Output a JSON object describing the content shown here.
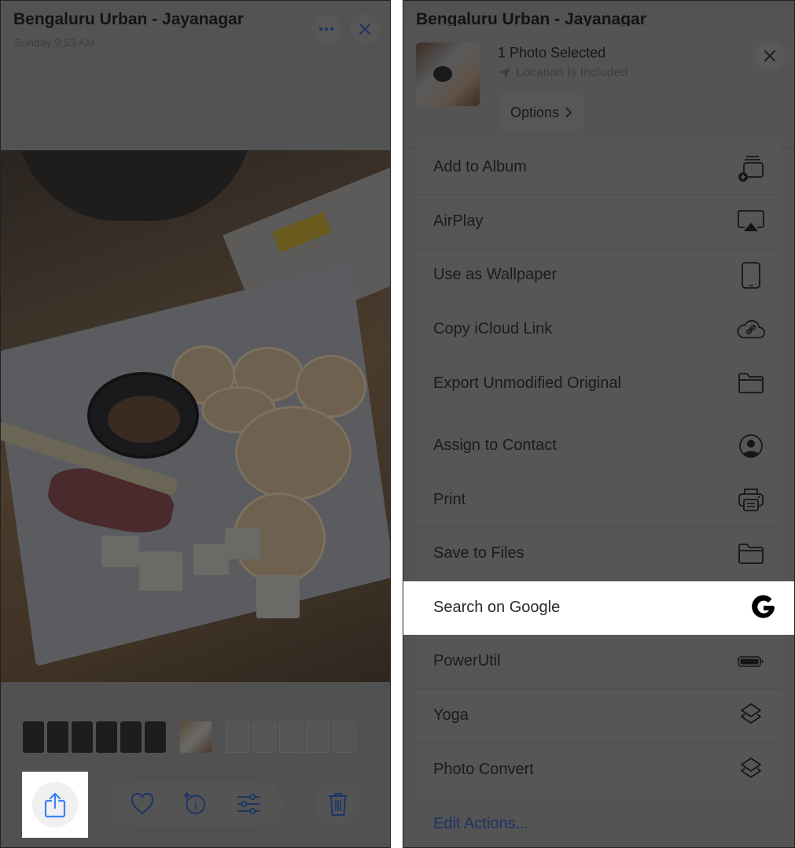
{
  "viewer": {
    "title": "Bengaluru Urban - Jayanagar",
    "subtitle": "Sunday  9:53 AM",
    "more_icon": "ellipsis-icon",
    "close_icon": "close-icon",
    "toolbar": {
      "share_icon": "share-icon",
      "favorite_icon": "heart-icon",
      "info_icon": "sparkle-info-icon",
      "adjust_icon": "sliders-icon",
      "delete_icon": "trash-icon"
    }
  },
  "share_sheet": {
    "background_title": "Bengaluru Urban - Jayanagar",
    "title": "1 Photo Selected",
    "location": "Location Is Included",
    "options_label": "Options",
    "group_1": [
      {
        "label": "Add to Album",
        "icon": "add-to-album-icon"
      },
      {
        "label": "AirPlay",
        "icon": "airplay-icon"
      },
      {
        "label": "Use as Wallpaper",
        "icon": "phone-icon"
      },
      {
        "label": "Copy iCloud Link",
        "icon": "cloud-link-icon"
      },
      {
        "label": "Export Unmodified Original",
        "icon": "folder-icon"
      }
    ],
    "group_2": [
      {
        "label": "Assign to Contact",
        "icon": "person-circle-icon"
      },
      {
        "label": "Print",
        "icon": "printer-icon"
      },
      {
        "label": "Save to Files",
        "icon": "folder-icon"
      },
      {
        "label": "Search on Google",
        "icon": "google-icon",
        "highlighted": true
      },
      {
        "label": "PowerUtil",
        "icon": "battery-icon"
      },
      {
        "label": "Yoga",
        "icon": "shortcuts-icon"
      },
      {
        "label": "Photo Convert",
        "icon": "shortcuts-icon"
      }
    ],
    "edit_actions_label": "Edit Actions..."
  },
  "colors": {
    "accent": "#1c3566",
    "share_accent": "#3b82f6",
    "highlight": "#ffffff"
  }
}
